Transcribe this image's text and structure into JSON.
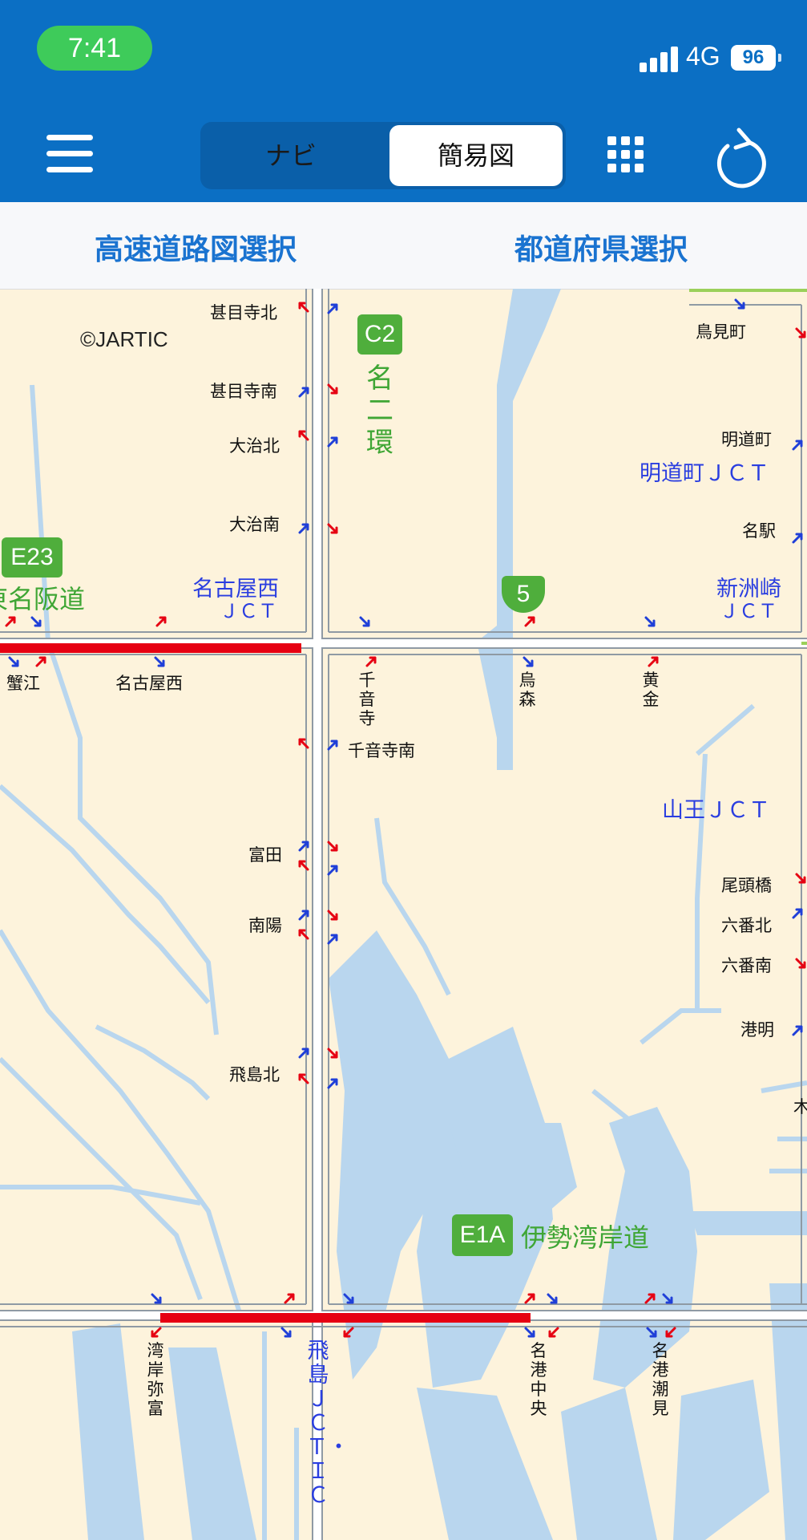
{
  "status": {
    "time": "7:41",
    "network": "4G",
    "battery": "96"
  },
  "toolbar": {
    "tabs": [
      {
        "label": "ナビ"
      },
      {
        "label": "簡易図"
      }
    ]
  },
  "selector": {
    "expressway_label": "高速道路図選択",
    "prefecture_label": "都道府県選択"
  },
  "map": {
    "copyright": "©JARTIC",
    "route_badges": {
      "c2": "C2",
      "e23": "E23",
      "r5": "5",
      "e1a": "E1A"
    },
    "route_names": {
      "c2": "名二環",
      "e23": "東名阪道",
      "e1a": "伊勢湾岸道"
    },
    "interchanges": {
      "jimokujikita": "甚目寺北",
      "jimokujiminami": "甚目寺南",
      "ojikita": "大治北",
      "ojiminami": "大治南",
      "kanie": "蟹江",
      "nagoyanishi": "名古屋西",
      "karasumicho": "鳥見町",
      "meidocho": "明道町",
      "meieki": "名駅",
      "senonji": "千音寺",
      "karasumori": "烏森",
      "kogane": "黄金",
      "senonjiminami": "千音寺南",
      "tomida": "富田",
      "nanyo": "南陽",
      "tobishimakita": "飛島北",
      "otobashi": "尾頭橋",
      "rokubankita": "六番北",
      "rokubanminami": "六番南",
      "komei": "港明",
      "ko_partial": "木",
      "wanganyatomi": "湾岸弥富",
      "meikochuo": "名港中央",
      "meikoshiomi": "名港潮見"
    },
    "junctions": {
      "nagoyanishi_jct": [
        "名古屋西",
        "ＪＣＴ"
      ],
      "meidocho_jct": "明道町ＪＣＴ",
      "shinsuzaki_jct": [
        "新洲崎",
        "ＪＣＴ"
      ],
      "sanno_jct": "山王ＪＣＴ",
      "tobishima_jct": "飛島ＪＣＴ・ＩＣ"
    }
  },
  "colors": {
    "header": "#0b6fc4",
    "congestion": "#e60012",
    "road_green": "#3fa635",
    "water": "#b9d6ee",
    "land": "#fdf3dc"
  }
}
